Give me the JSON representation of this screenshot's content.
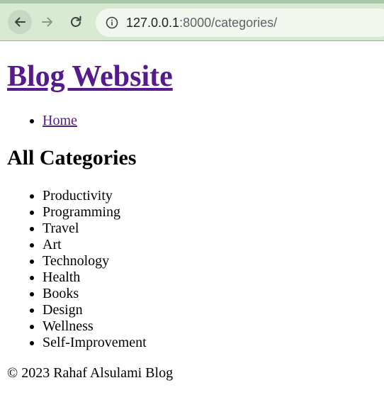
{
  "browser": {
    "url_host": "127.0.0.1",
    "url_path": ":8000/categories/",
    "icons": {
      "back": "back-arrow-icon",
      "forward": "forward-arrow-icon",
      "reload": "reload-icon",
      "site_info": "info-icon"
    }
  },
  "header": {
    "site_title": "Blog Website"
  },
  "nav": {
    "items": [
      {
        "label": "Home"
      }
    ]
  },
  "main": {
    "section_title": "All Categories",
    "categories": [
      {
        "label": "Productivity"
      },
      {
        "label": "Programming"
      },
      {
        "label": "Travel"
      },
      {
        "label": "Art"
      },
      {
        "label": "Technology"
      },
      {
        "label": "Health"
      },
      {
        "label": "Books"
      },
      {
        "label": "Design"
      },
      {
        "label": "Wellness"
      },
      {
        "label": "Self-Improvement"
      }
    ]
  },
  "footer": {
    "text": "© 2023 Rahaf Alsulami Blog"
  },
  "colors": {
    "link_visited": "#551a8b",
    "toolbar_bg": "#d9ead3",
    "address_bg": "#f1f7ef"
  }
}
